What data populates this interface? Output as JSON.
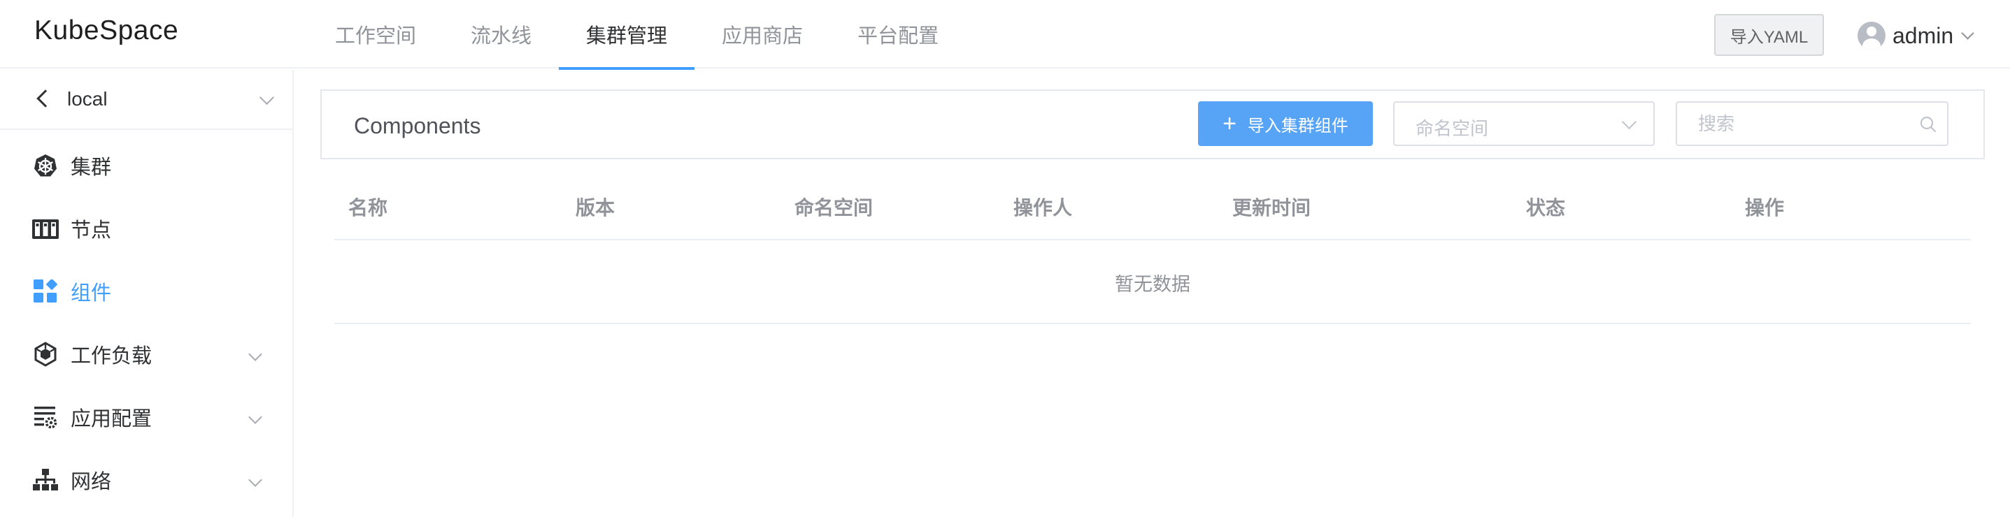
{
  "app": {
    "logo": "KubeSpace"
  },
  "nav": {
    "tabs": [
      {
        "label": "工作空间"
      },
      {
        "label": "流水线"
      },
      {
        "label": "集群管理"
      },
      {
        "label": "应用商店"
      },
      {
        "label": "平台配置"
      }
    ],
    "active_index": 2
  },
  "header": {
    "import_yaml_label": "导入YAML",
    "user_name": "admin"
  },
  "sidebar": {
    "cluster_name": "local",
    "items": [
      {
        "label": "集群",
        "icon": "kubernetes-wheel-icon"
      },
      {
        "label": "节点",
        "icon": "server-rack-icon"
      },
      {
        "label": "组件",
        "icon": "components-grid-icon",
        "active": true
      },
      {
        "label": "工作负载",
        "icon": "cube-icon",
        "expandable": true
      },
      {
        "label": "应用配置",
        "icon": "config-list-icon",
        "expandable": true
      },
      {
        "label": "网络",
        "icon": "network-tree-icon",
        "expandable": true
      }
    ]
  },
  "main": {
    "title": "Components",
    "import_button_label": "导入集群组件",
    "namespace_placeholder": "命名空间",
    "search_placeholder": "搜索",
    "table": {
      "columns": [
        "名称",
        "版本",
        "命名空间",
        "操作人",
        "更新时间",
        "状态",
        "操作"
      ],
      "rows": [],
      "empty_text": "暂无数据"
    }
  },
  "colors": {
    "accent": "#409eff",
    "primary_button": "#57a3f5",
    "muted_text": "#909399"
  }
}
